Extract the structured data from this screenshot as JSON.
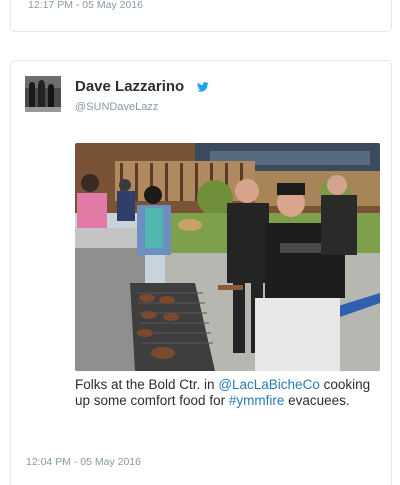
{
  "previous_tweet": {
    "timestamp": "12:17 PM - 05 May 2016"
  },
  "tweet": {
    "author_name": "Dave Lazzarino",
    "verified_icon": "twitter-bird-icon",
    "handle": "@SUNDaveLazz",
    "text_part1": "Folks at the Bold Ctr. in ",
    "mention": "@LacLaBicheCo",
    "text_part2": " cooking up some comfort food for ",
    "hashtag": "#ymmfire",
    "text_part3": " evacuees.",
    "timestamp": "12:04 PM - 05 May 2016"
  },
  "colors": {
    "link": "#2b7bb9",
    "muted": "#8899a6",
    "border": "#e1e8ed",
    "twitter_blue": "#1da1f2"
  }
}
